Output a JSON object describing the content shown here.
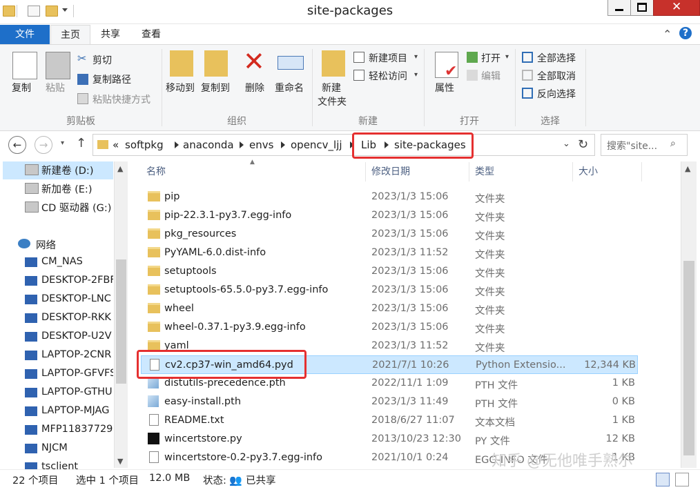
{
  "window": {
    "title": "site-packages"
  },
  "ribbon_tabs": {
    "file": "文件",
    "home": "主页",
    "share": "共享",
    "view": "查看"
  },
  "ribbon": {
    "clipboard": {
      "copy": "复制",
      "paste": "粘贴",
      "cut": "剪切",
      "copy_path": "复制路径",
      "paste_shortcut": "粘贴快捷方式",
      "label": "剪贴板"
    },
    "organize": {
      "move_to": "移动到",
      "copy_to": "复制到",
      "delete": "删除",
      "rename": "重命名",
      "label": "组织"
    },
    "new": {
      "new_folder_1": "新建",
      "new_folder_2": "文件夹",
      "new_item": "新建项目",
      "easy_access": "轻松访问",
      "label": "新建"
    },
    "open": {
      "properties": "属性",
      "open": "打开",
      "edit": "编辑",
      "label": "打开"
    },
    "select": {
      "select_all": "全部选择",
      "select_none": "全部取消",
      "invert": "反向选择",
      "label": "选择"
    }
  },
  "address": {
    "overflow": "«",
    "crumbs": [
      "softpkg",
      "anaconda",
      "envs",
      "opencv_ljj",
      "Lib",
      "site-packages"
    ],
    "search_placeholder": "搜索\"site..."
  },
  "nav": {
    "items": [
      "新建卷 (D:)",
      "新加卷 (E:)",
      "CD 驱动器 (G:)",
      "网络",
      "CM_NAS",
      "DESKTOP-2FBF",
      "DESKTOP-LNC",
      "DESKTOP-RKK",
      "DESKTOP-U2V",
      "LAPTOP-2CNR",
      "LAPTOP-GFVFS",
      "LAPTOP-GTHU",
      "LAPTOP-MJAG",
      "MFP11837729",
      "NJCM",
      "tsclient"
    ]
  },
  "columns": {
    "name": "名称",
    "date": "修改日期",
    "type": "类型",
    "size": "大小"
  },
  "files": [
    {
      "name": "pip",
      "date": "2023/1/3 15:06",
      "type": "文件夹",
      "size": "",
      "icon": "folder"
    },
    {
      "name": "pip-22.3.1-py3.7.egg-info",
      "date": "2023/1/3 15:06",
      "type": "文件夹",
      "size": "",
      "icon": "folder"
    },
    {
      "name": "pkg_resources",
      "date": "2023/1/3 15:06",
      "type": "文件夹",
      "size": "",
      "icon": "folder"
    },
    {
      "name": "PyYAML-6.0.dist-info",
      "date": "2023/1/3 11:52",
      "type": "文件夹",
      "size": "",
      "icon": "folder"
    },
    {
      "name": "setuptools",
      "date": "2023/1/3 15:06",
      "type": "文件夹",
      "size": "",
      "icon": "folder"
    },
    {
      "name": "setuptools-65.5.0-py3.7.egg-info",
      "date": "2023/1/3 15:06",
      "type": "文件夹",
      "size": "",
      "icon": "folder"
    },
    {
      "name": "wheel",
      "date": "2023/1/3 15:06",
      "type": "文件夹",
      "size": "",
      "icon": "folder"
    },
    {
      "name": "wheel-0.37.1-py3.9.egg-info",
      "date": "2023/1/3 15:06",
      "type": "文件夹",
      "size": "",
      "icon": "folder"
    },
    {
      "name": "yaml",
      "date": "2023/1/3 11:52",
      "type": "文件夹",
      "size": "",
      "icon": "folder"
    },
    {
      "name": "cv2.cp37-win_amd64.pyd",
      "date": "2021/7/1 10:26",
      "type": "Python Extensio...",
      "size": "12,344 KB",
      "icon": "pyd"
    },
    {
      "name": "distutils-precedence.pth",
      "date": "2022/11/1 1:09",
      "type": "PTH 文件",
      "size": "1 KB",
      "icon": "pth"
    },
    {
      "name": "easy-install.pth",
      "date": "2023/1/3 11:49",
      "type": "PTH 文件",
      "size": "0 KB",
      "icon": "pth"
    },
    {
      "name": "README.txt",
      "date": "2018/6/27 11:07",
      "type": "文本文档",
      "size": "1 KB",
      "icon": "txt"
    },
    {
      "name": "wincertstore.py",
      "date": "2013/10/23 12:30",
      "type": "PY 文件",
      "size": "12 KB",
      "icon": "py"
    },
    {
      "name": "wincertstore-0.2-py3.7.egg-info",
      "date": "2021/10/1 0:24",
      "type": "EGG-INFO 文件",
      "size": "1 KB",
      "icon": "file"
    }
  ],
  "status": {
    "count": "22 个项目",
    "selected": "选中 1 个项目",
    "size": "12.0 MB",
    "state_label": "状态:",
    "shared": "已共享"
  },
  "watermark": "知乎 @无他唯手熟尔"
}
